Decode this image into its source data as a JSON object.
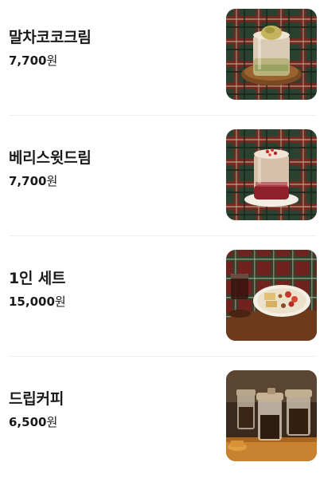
{
  "menu": {
    "currency_unit": "원",
    "items": [
      {
        "name": "말차코코크림",
        "price": "7,700",
        "photo_icon": "matcha-coconut-cream-drink-photo"
      },
      {
        "name": "베리스윗드림",
        "price": "7,700",
        "photo_icon": "berry-sweet-dream-drink-photo"
      },
      {
        "name": "1인 세트",
        "price": "15,000",
        "photo_icon": "single-set-plate-photo"
      },
      {
        "name": "드립커피",
        "price": "6,500",
        "photo_icon": "drip-coffee-jars-photo"
      }
    ]
  },
  "colors": {
    "tartan_green": "#2e4a35",
    "tartan_red": "#9c2b24",
    "text": "#1a1a1a",
    "divider": "#efefef"
  }
}
